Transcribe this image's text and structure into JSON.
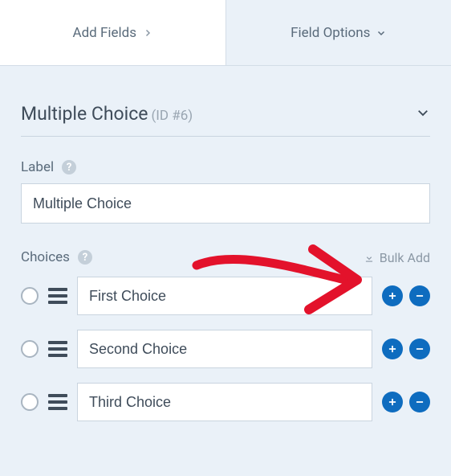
{
  "tabs": {
    "add_fields": "Add Fields",
    "field_options": "Field Options"
  },
  "section": {
    "title": "Multiple Choice",
    "id_label": "(ID #6)"
  },
  "label_field": {
    "caption": "Label",
    "value": "Multiple Choice"
  },
  "choices": {
    "caption": "Choices",
    "bulk_add": "Bulk Add",
    "items": [
      {
        "value": "First Choice"
      },
      {
        "value": "Second Choice"
      },
      {
        "value": "Third Choice"
      }
    ]
  }
}
